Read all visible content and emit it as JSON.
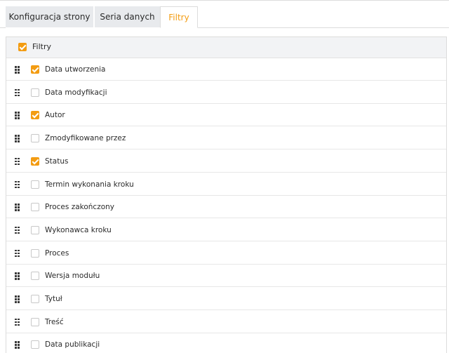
{
  "tabs": [
    {
      "label": "Konfiguracja strony",
      "active": false
    },
    {
      "label": "Seria danych",
      "active": false
    },
    {
      "label": "Filtry",
      "active": true
    }
  ],
  "panel": {
    "header": {
      "label": "Filtry",
      "checked": true
    },
    "items": [
      {
        "label": "Data utworzenia",
        "checked": true
      },
      {
        "label": "Data modyfikacji",
        "checked": false
      },
      {
        "label": "Autor",
        "checked": true
      },
      {
        "label": "Zmodyfikowane przez",
        "checked": false
      },
      {
        "label": "Status",
        "checked": true
      },
      {
        "label": "Termin wykonania kroku",
        "checked": false
      },
      {
        "label": "Proces zakończony",
        "checked": false
      },
      {
        "label": "Wykonawca kroku",
        "checked": false
      },
      {
        "label": "Proces",
        "checked": false
      },
      {
        "label": "Wersja modułu",
        "checked": false
      },
      {
        "label": "Tytuł",
        "checked": false
      },
      {
        "label": "Treść",
        "checked": false
      },
      {
        "label": "Data publikacji",
        "checked": false
      }
    ]
  },
  "colors": {
    "accent": "#f39c12",
    "tab_inactive_bg": "#e8eaed",
    "header_bg": "#f2f3f5"
  },
  "icons": {
    "drag_handle": "drag-handle-icon",
    "checkbox_checked": "checkmark-icon"
  }
}
